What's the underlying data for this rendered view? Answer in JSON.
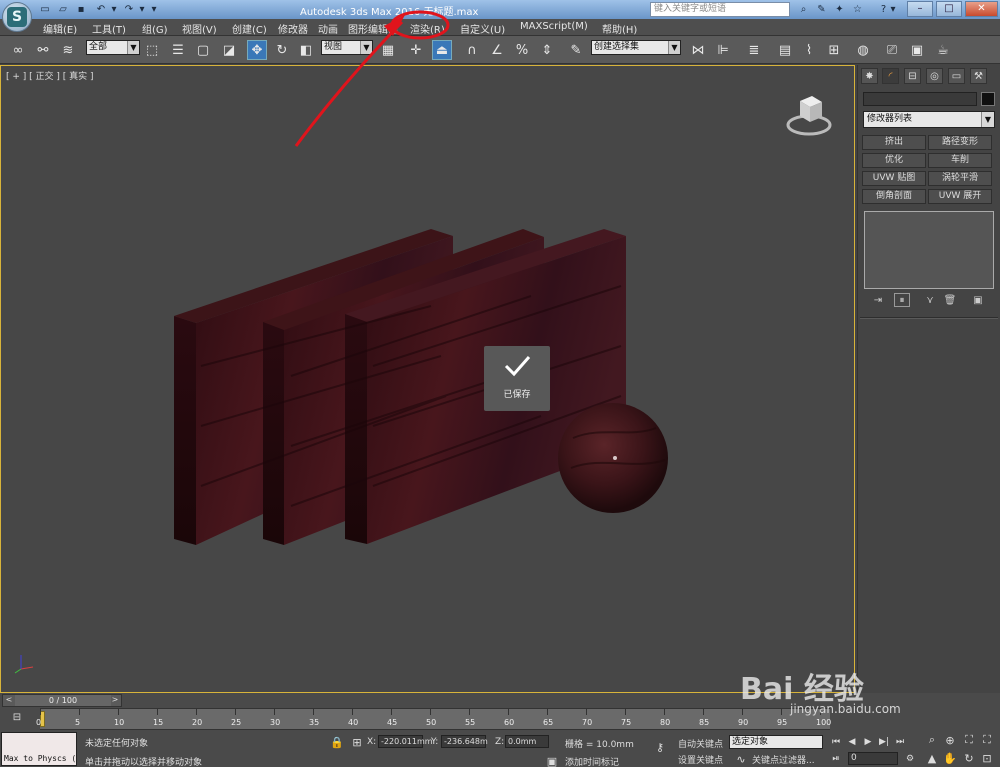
{
  "title_bar": {
    "title": "Autodesk 3ds Max  2016      无标题.max",
    "search_placeholder": "键入关键字或短语",
    "buttons": [
      "minimize",
      "maximize",
      "close"
    ]
  },
  "menu": [
    "编辑(E)",
    "工具(T)",
    "组(G)",
    "视图(V)",
    "创建(C)",
    "修改器",
    "动画",
    "图形编辑器",
    "渲染(R)",
    "自定义(U)",
    "MAXScript(M)",
    "帮助(H)"
  ],
  "toolbar": {
    "selection_filter": "全部",
    "reference_coord": "视图",
    "named_selection": "创建选择集"
  },
  "viewport": {
    "label": "[ + ] [ 正交 ] [ 真实 ]",
    "toast": {
      "label": "已保存",
      "icon": "checkmark-icon"
    }
  },
  "command_panel": {
    "modifier_list": "修改器列表",
    "modifier_buttons": [
      [
        "挤出",
        "路径变形"
      ],
      [
        "优化",
        "车削"
      ],
      [
        "UVW 贴图",
        "涡轮平滑"
      ],
      [
        "倒角剖面",
        "UVW 展开"
      ]
    ]
  },
  "timeline": {
    "frame_display": "0 / 100",
    "ticks": [
      "0",
      "5",
      "10",
      "15",
      "20",
      "25",
      "30",
      "35",
      "40",
      "45",
      "50",
      "55",
      "60",
      "65",
      "70",
      "75",
      "80",
      "85",
      "90",
      "95",
      "100"
    ]
  },
  "status": {
    "maxscript": "Max to Physcs (",
    "line1": "未选定任何对象",
    "line2": "单击并拖动以选择并移动对象",
    "x_label": "X:",
    "x": "-220.011mm",
    "y_label": "Y:",
    "y": "-236.648m",
    "z_label": "Z:",
    "z": "0.0mm",
    "grid": "栅格 = 10.0mm",
    "add_time_tag": "添加时间标记",
    "auto_key": "自动关键点",
    "set_key": "设置关键点",
    "selected_object": "选定对象",
    "key_filters": "关键点过滤器...",
    "current_frame": "0"
  },
  "watermark": {
    "brand": "Bai 经验",
    "url": "jingyan.baidu.com"
  },
  "annotation_color": "#e0141c"
}
